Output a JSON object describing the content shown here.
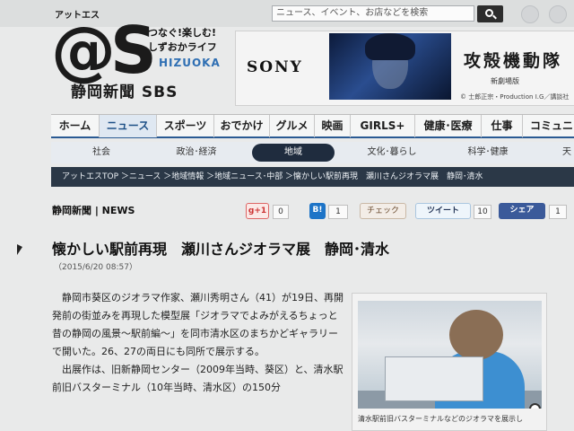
{
  "header": {
    "logo_kana": "アットエス",
    "logo_at": "@S",
    "tagline1": "つなぐ!楽しむ!",
    "tagline2": "しずおかライフ",
    "shizuoka": "HIZUOKA",
    "paper": "静岡新聞 SBS",
    "search_placeholder": "ニュース、イベント、お店などを検索"
  },
  "banner": {
    "brand": "SONY",
    "title": "攻殻機動隊",
    "subtitle": "新劇場版",
    "credit": "© 士郎正宗・Production I.G／講談社"
  },
  "nav": [
    {
      "label": "ホーム",
      "active": false
    },
    {
      "label": "ニュース",
      "active": true
    },
    {
      "label": "スポーツ",
      "active": false
    },
    {
      "label": "おでかけ",
      "active": false
    },
    {
      "label": "グルメ",
      "active": false
    },
    {
      "label": "映画",
      "active": false
    },
    {
      "label": "GIRLS+",
      "active": false
    },
    {
      "label": "健康･医療",
      "active": false
    },
    {
      "label": "仕事",
      "active": false
    },
    {
      "label": "コミュニ",
      "active": false
    }
  ],
  "subnav": [
    {
      "label": "社会",
      "active": false
    },
    {
      "label": "政治･経済",
      "active": false
    },
    {
      "label": "地域",
      "active": true
    },
    {
      "label": "文化･暮らし",
      "active": false
    },
    {
      "label": "科学･健康",
      "active": false
    },
    {
      "label": "天",
      "active": false
    }
  ],
  "breadcrumb": "アットエスTOP ＞ニュース ＞地域情報 ＞地域ニュース･中部 ＞懐かしい駅前再現　瀬川さんジオラマ展　静岡･清水",
  "source": "静岡新聞 | NEWS",
  "share": {
    "gplus_label": "g+1",
    "gplus_count": "0",
    "hatena_label": "B!",
    "hatena_count": "1",
    "check_label": "チェック",
    "tweet_label": "ツイート",
    "tweet_count": "10",
    "fb_label": "シェア",
    "fb_count": "1"
  },
  "article": {
    "title": "懐かしい駅前再現　瀬川さんジオラマ展　静岡･清水",
    "date": "（2015/6/20 08:57）",
    "para1": "静岡市葵区のジオラマ作家、瀬川秀明さん（41）が19日、再開発前の街並みを再現した模型展「ジオラマでよみがえるちょっと昔の静岡の風景～駅前編～」を同市清水区のまちかどギャラリーで開いた。26、27の両日にも同所で展示する。",
    "para2": "出展作は、旧新静岡センター（2009年当時、葵区）と、清水駅前旧バスターミナル（10年当時、清水区）の150分",
    "caption": "清水駅前旧バスターミナルなどのジオラマを展示し"
  }
}
